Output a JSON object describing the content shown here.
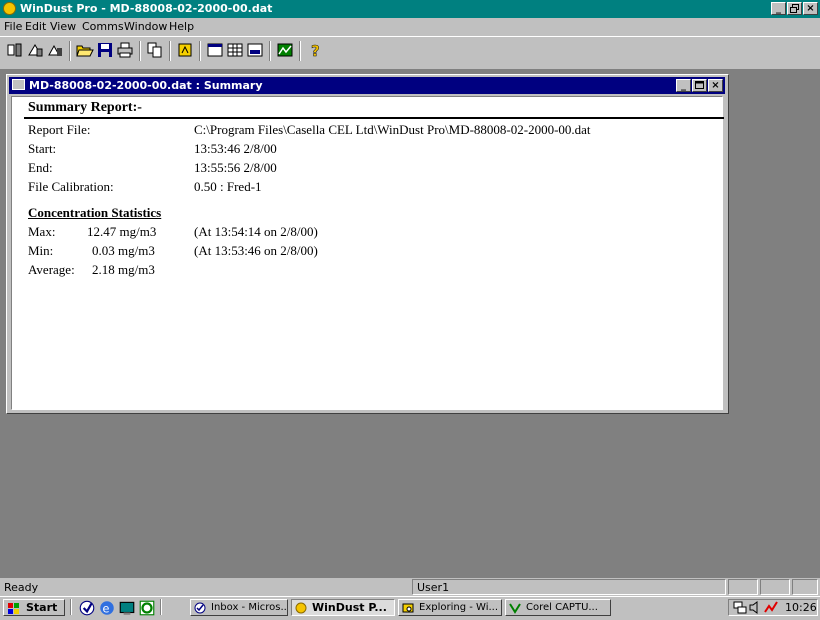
{
  "app": {
    "title": "WinDust Pro - MD-88008-02-2000-00.dat",
    "minimize": "_",
    "maximize": " ",
    "close": "×"
  },
  "menu": [
    "File",
    "Edit",
    "View",
    "Comms",
    "Window",
    "Help"
  ],
  "child": {
    "title": "MD-88008-02-2000-00.dat : Summary"
  },
  "report": {
    "heading": "Summary Report:-",
    "report_file_label": "Report File:",
    "report_file_value": "C:\\Program Files\\Casella CEL Ltd\\WinDust Pro\\MD-88008-02-2000-00.dat",
    "start_label": "Start:",
    "start_value": "13:53:46  2/8/00",
    "end_label": "End:",
    "end_value": "13:55:56  2/8/00",
    "calibration_label": "File Calibration:",
    "calibration_value": "0.50  : Fred-1",
    "stats_heading": "Concentration Statistics",
    "max_label": "Max:",
    "max_value": "12.47 mg/m3",
    "max_when": "(At 13:54:14 on 2/8/00)",
    "min_label": "Min:",
    "min_value": "0.03 mg/m3",
    "min_when": "(At 13:53:46 on 2/8/00)",
    "average_label": "Average:",
    "average_value": "2.18 mg/m3"
  },
  "status": {
    "ready": "Ready",
    "user": "User1"
  },
  "taskbar": {
    "start": "Start",
    "tasks": [
      "Inbox - Micros...",
      "WinDust P...",
      "Exploring - Wi...",
      "Corel CAPTU..."
    ],
    "clock": "10:26"
  }
}
